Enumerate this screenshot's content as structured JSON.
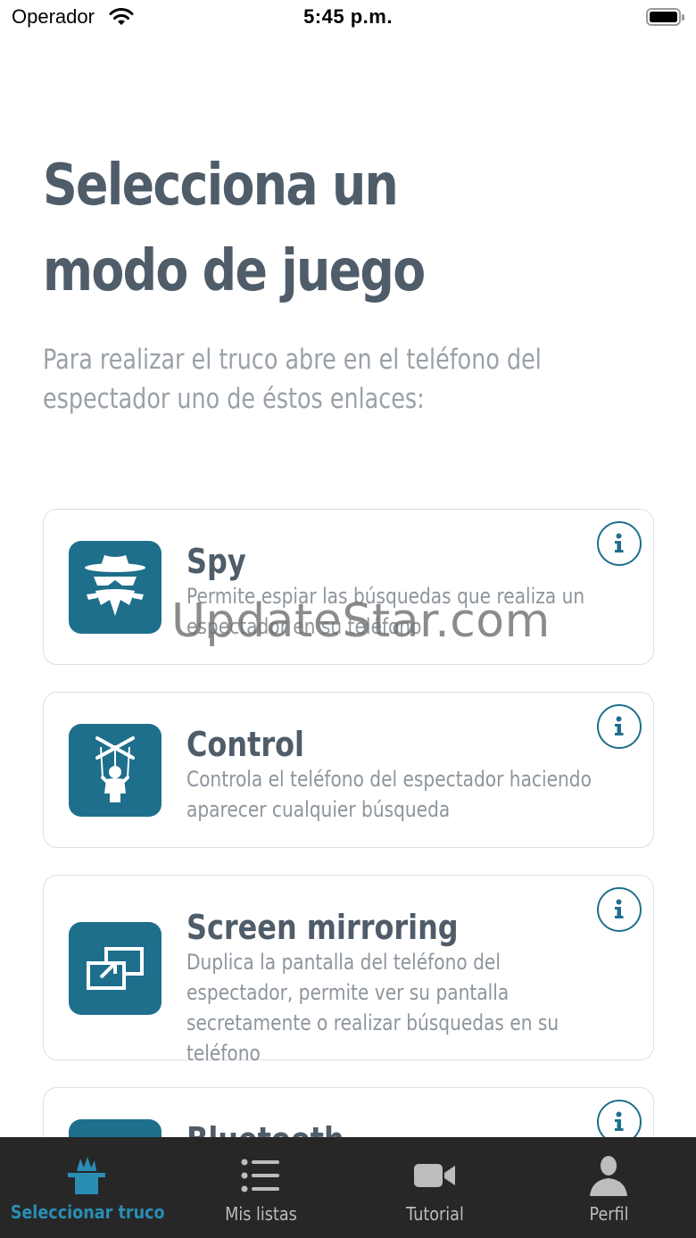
{
  "status_bar": {
    "carrier": "Operador",
    "time": "5:45 p.m."
  },
  "header": {
    "title": "Selecciona un modo de juego",
    "subtitle": "Para realizar el truco abre en el teléfono del espectador uno de éstos enlaces:"
  },
  "modes": [
    {
      "title": "Spy",
      "description": "Permite espiar las búsquedas que realiza un espectador en su teléfono",
      "icon": "spy-icon"
    },
    {
      "title": "Control",
      "description": "Controla el teléfono del espectador haciendo aparecer cualquier búsqueda",
      "icon": "puppet-icon"
    },
    {
      "title": "Screen mirroring",
      "description": "Duplica la pantalla del teléfono del espectador, permite ver su pantalla secretamente o realizar búsquedas en su teléfono",
      "icon": "screen-mirroring-icon"
    },
    {
      "title": "Bluetooth",
      "description": "",
      "icon": "bluetooth-icon"
    }
  ],
  "watermark": "UpdateStar.com",
  "tab_bar": {
    "active_index": 0,
    "accent_color": "#2a8db3",
    "tabs": [
      {
        "label": "Seleccionar truco",
        "icon": "magic-hat-icon"
      },
      {
        "label": "Mis listas",
        "icon": "list-icon"
      },
      {
        "label": "Tutorial",
        "icon": "video-camera-icon"
      },
      {
        "label": "Perfil",
        "icon": "person-icon"
      }
    ]
  },
  "colors": {
    "brand": "#1e6f8c",
    "title_text": "#4f5c69",
    "body_text": "#8d959d",
    "tab_bar_bg": "#272727"
  }
}
